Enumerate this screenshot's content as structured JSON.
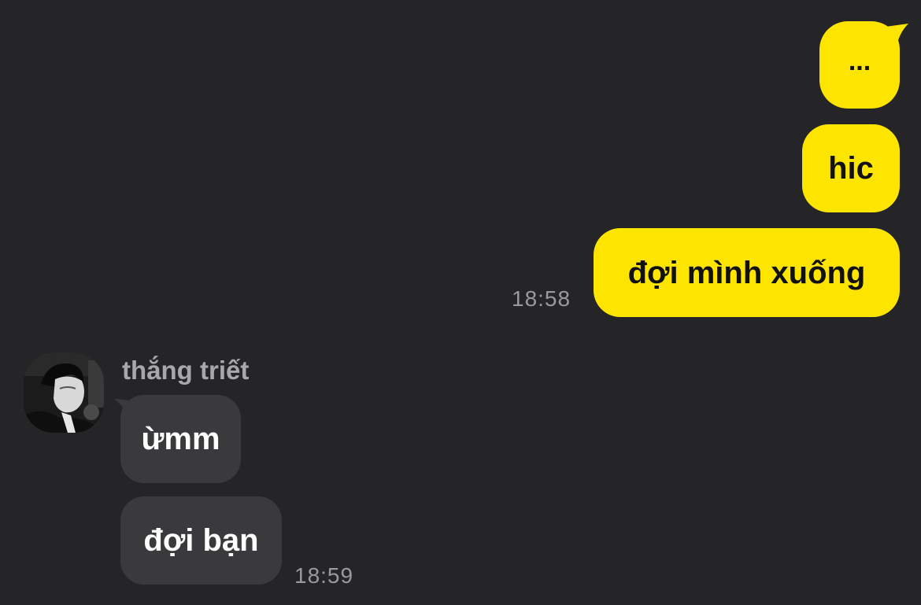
{
  "conversation": {
    "outgoing": [
      {
        "text": "..."
      },
      {
        "text": "hic"
      },
      {
        "text": "đợi mình xuống",
        "time": "18:58"
      }
    ],
    "contact": {
      "name": "thắng triết",
      "avatar_icon": "profile-photo"
    },
    "incoming": [
      {
        "text": "ừmm"
      },
      {
        "text": "đợi bạn",
        "time": "18:59"
      }
    ]
  },
  "colors": {
    "background": "#252527",
    "outgoing_bubble": "#FEE500",
    "incoming_bubble": "#3A3A3C",
    "timestamp": "#9A9A9C"
  }
}
